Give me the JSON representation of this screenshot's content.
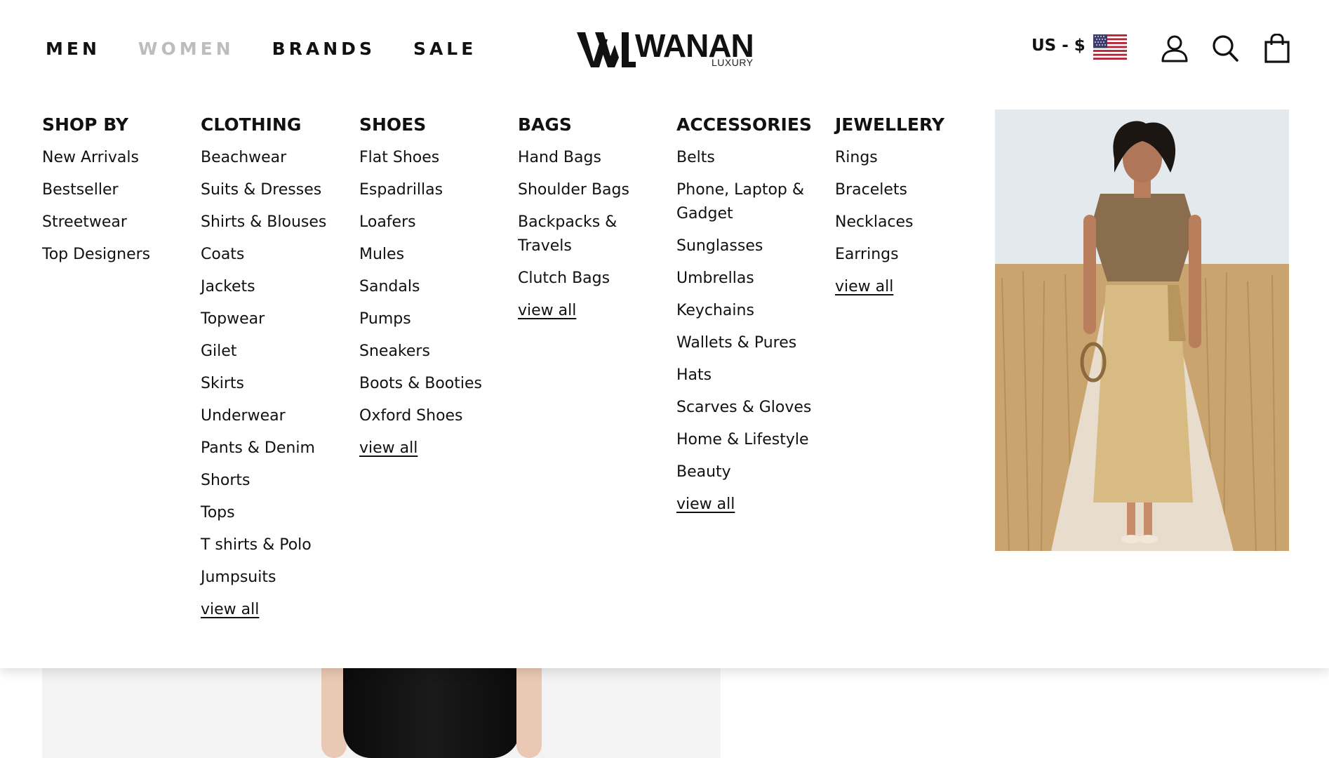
{
  "header": {
    "nav": [
      {
        "label": "MEN",
        "active": false
      },
      {
        "label": "WOMEN",
        "active": true
      },
      {
        "label": "BRANDS",
        "active": false
      },
      {
        "label": "SALE",
        "active": false
      }
    ],
    "logo": {
      "main": "WANAN",
      "sub": "LUXURY"
    },
    "currency": "US - $",
    "icons": [
      "us-flag-icon",
      "user-icon",
      "search-icon",
      "shopping-bag-icon"
    ]
  },
  "menu": {
    "columns": [
      {
        "title": "SHOP BY",
        "items": [
          "New Arrivals",
          "Bestseller",
          "Streetwear",
          "Top Designers"
        ]
      },
      {
        "title": "CLOTHING",
        "items": [
          "Beachwear",
          "Suits & Dresses",
          "Shirts & Blouses",
          "Coats",
          "Jackets",
          "Topwear",
          "Gilet",
          "Skirts",
          "Underwear",
          "Pants & Denim",
          "Shorts",
          "Tops",
          "T shirts & Polo",
          "Jumpsuits",
          "view all"
        ]
      },
      {
        "title": "SHOES",
        "items": [
          "Flat Shoes",
          "Espadrillas",
          "Loafers",
          "Mules",
          "Sandals",
          "Pumps",
          "Sneakers",
          "Boots & Booties",
          "Oxford Shoes",
          "view all"
        ]
      },
      {
        "title": "BAGS",
        "items": [
          "Hand Bags",
          "Shoulder Bags",
          "Backpacks & Travels",
          "Clutch Bags",
          "view all"
        ]
      },
      {
        "title": "ACCESSORIES",
        "items": [
          "Belts",
          "Phone, Laptop & Gadget",
          "Sunglasses",
          "Umbrellas",
          "Keychains",
          "Wallets & Pures",
          "Hats",
          "Scarves & Gloves",
          "Home & Lifestyle",
          "Beauty",
          "view all"
        ]
      },
      {
        "title": "JEWELLERY",
        "items": [
          "Rings",
          "Bracelets",
          "Necklaces",
          "Earrings",
          "view all"
        ]
      }
    ]
  },
  "colors": {
    "text": "#111111",
    "nav_active": "#bdbdbd",
    "background": "#ffffff"
  }
}
